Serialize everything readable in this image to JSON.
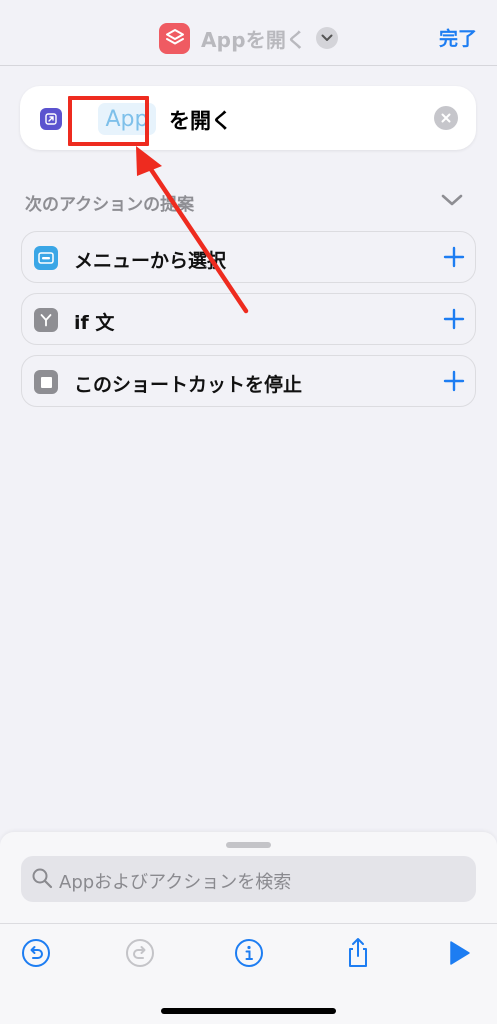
{
  "nav": {
    "title": "Appを開く",
    "done_label": "完了",
    "app_icon": "shortcuts-layers-icon",
    "accent_color": "#1d7df2"
  },
  "action": {
    "icon": "open-app-icon",
    "app_token": "App",
    "suffix": "を開く",
    "clear_icon": "clear-circle-icon"
  },
  "suggestions": {
    "header": "次のアクションの提案",
    "items": [
      {
        "label": "メニューから選択",
        "icon": "menu-choose-icon",
        "icon_color": "#3aa6e6"
      },
      {
        "label": "if 文",
        "icon": "if-branch-icon",
        "icon_color": "#8e8e93"
      },
      {
        "label": "このショートカットを停止",
        "icon": "stop-square-icon",
        "icon_color": "#8e8e93"
      }
    ]
  },
  "search": {
    "placeholder": "Appおよびアクションを検索"
  },
  "toolbar": {
    "items": [
      "undo-icon",
      "redo-icon",
      "info-icon",
      "share-icon",
      "play-icon"
    ]
  },
  "annotation": {
    "highlight_color": "#ee2b1f"
  }
}
